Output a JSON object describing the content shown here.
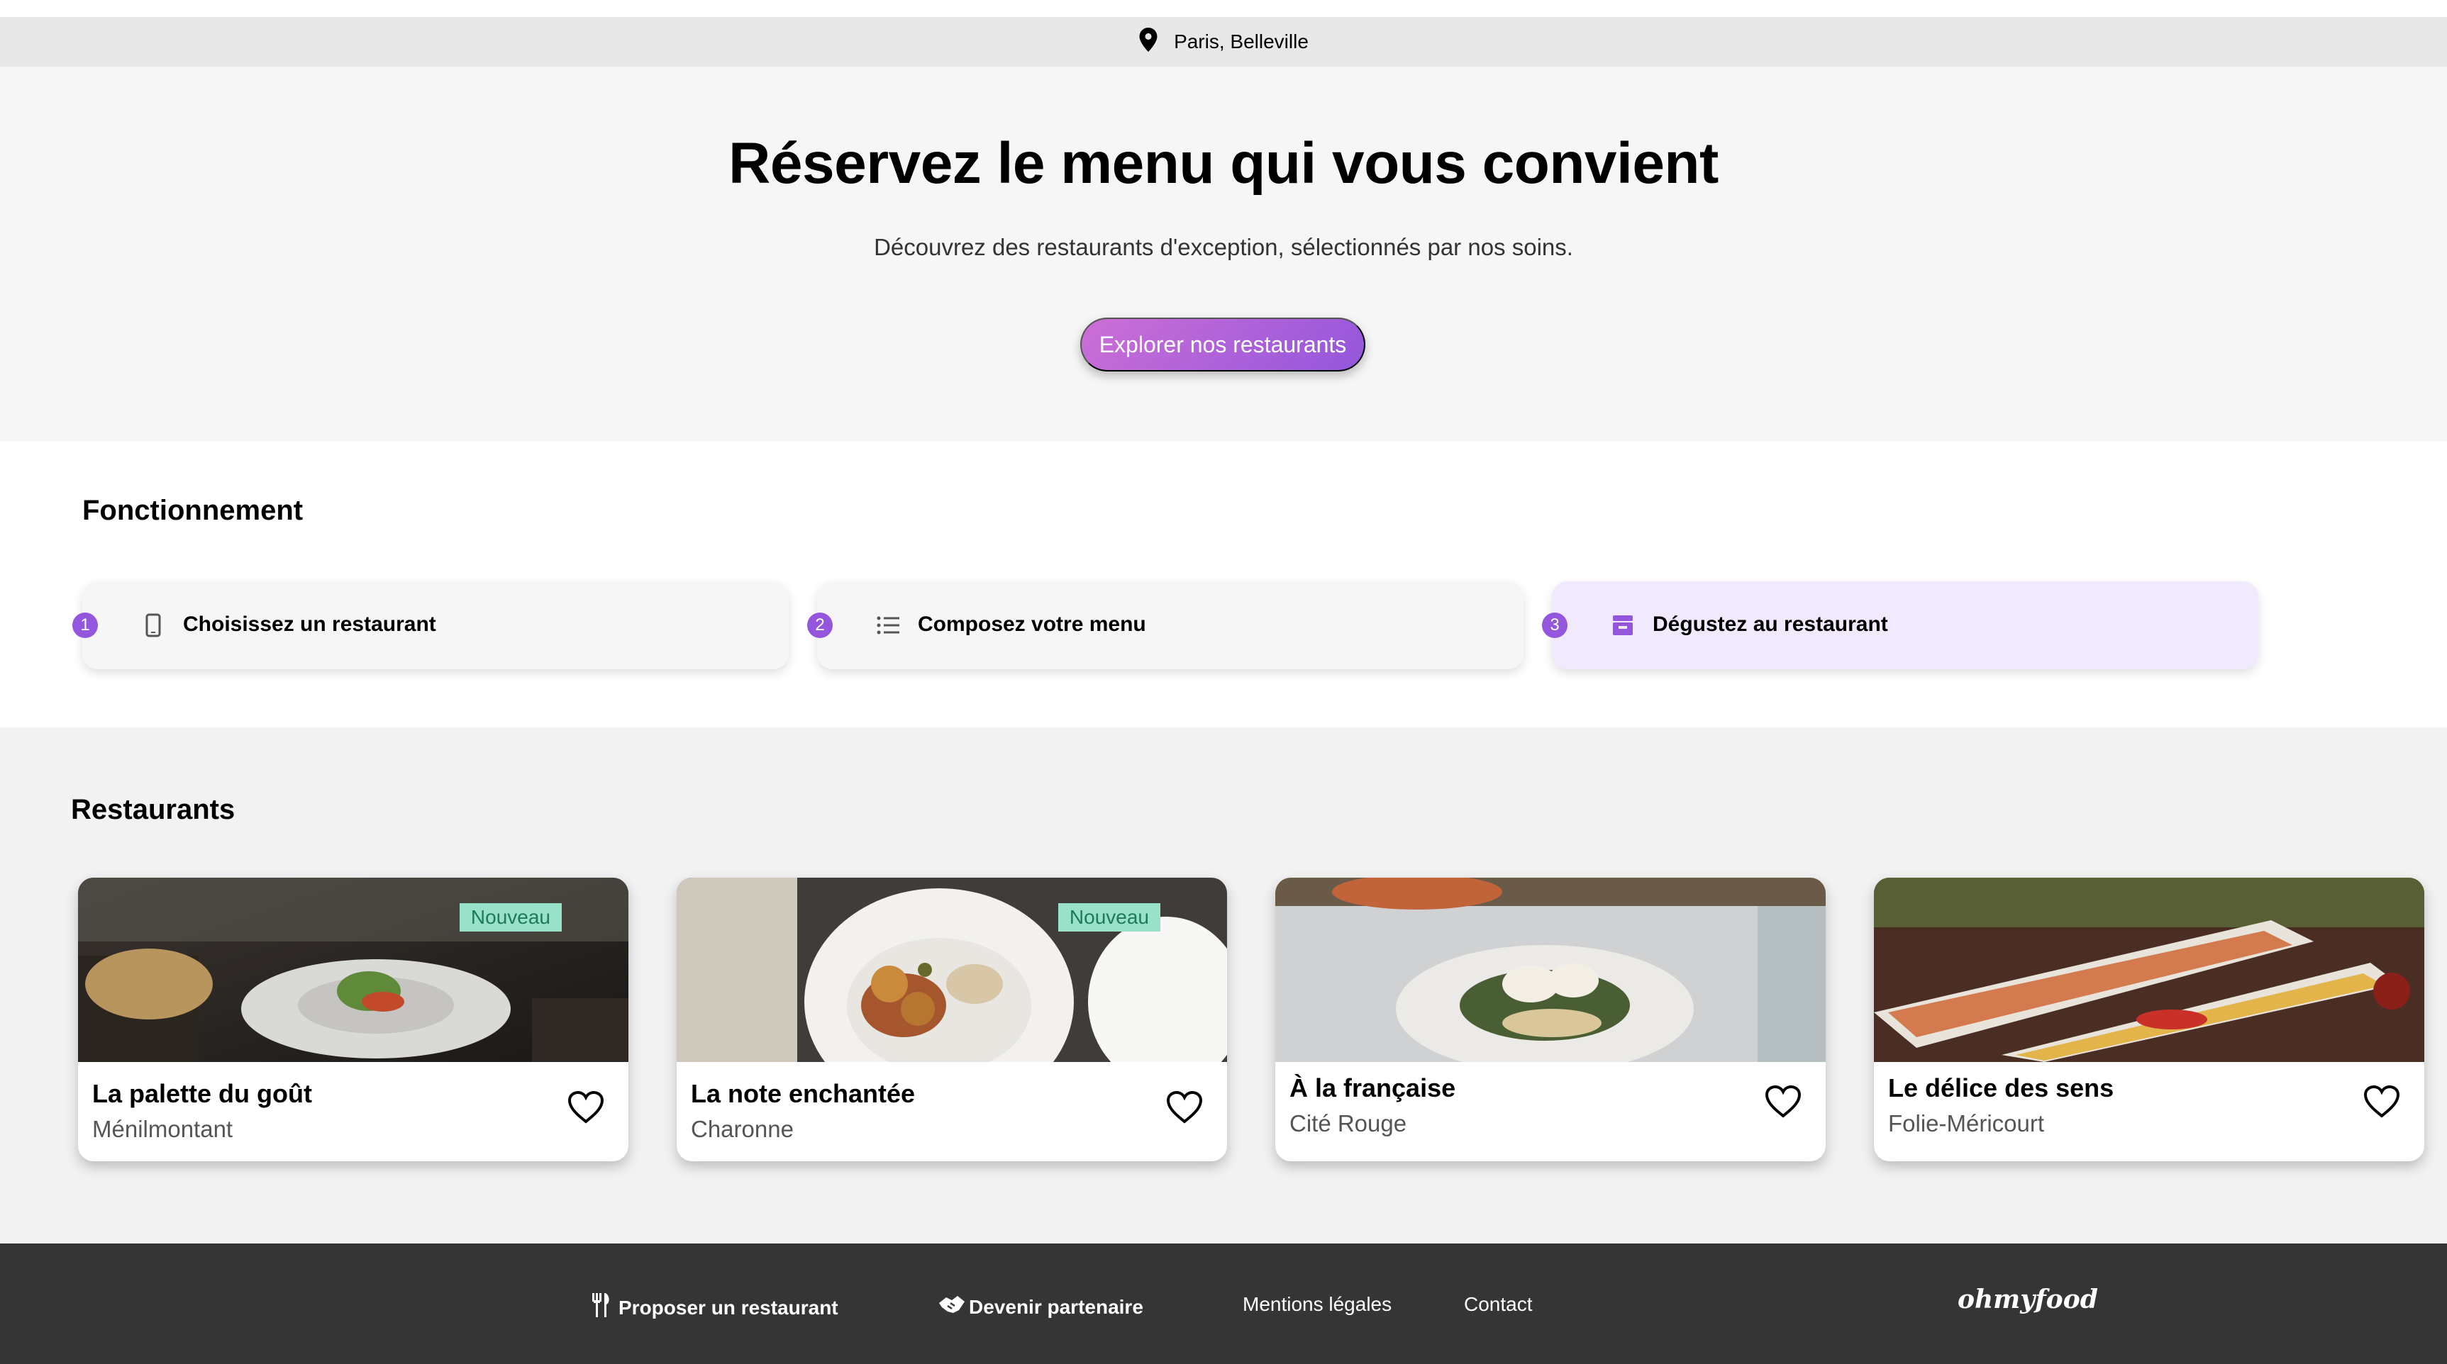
{
  "location": {
    "text": "Paris, Belleville",
    "icon": "map-pin-icon"
  },
  "hero": {
    "title": "Réservez le menu qui vous convient",
    "subtitle": "Découvrez des restaurants d'exception, sélectionnés par nos soins.",
    "cta_label": "Explorer nos restaurants"
  },
  "how_it_works": {
    "title": "Fonctionnement",
    "steps": [
      {
        "number": "1",
        "label": "Choisissez un restaurant",
        "icon": "smartphone-icon"
      },
      {
        "number": "2",
        "label": "Composez votre menu",
        "icon": "list-icon"
      },
      {
        "number": "3",
        "label": "Dégustez au restaurant",
        "icon": "store-icon"
      }
    ]
  },
  "restaurants": {
    "title": "Restaurants",
    "items": [
      {
        "name": "La palette du goût",
        "area": "Ménilmontant",
        "badge": "Nouveau"
      },
      {
        "name": "La note enchantée",
        "area": "Charonne",
        "badge": "Nouveau"
      },
      {
        "name": "À la française",
        "area": "Cité Rouge"
      },
      {
        "name": "Le délice des sens",
        "area": "Folie-Méricourt"
      }
    ]
  },
  "footer": {
    "links": [
      {
        "label": "Proposer un restaurant",
        "icon": "utensils-icon"
      },
      {
        "label": "Devenir partenaire",
        "icon": "handshake-icon"
      },
      {
        "label": "Mentions légales"
      },
      {
        "label": "Contact"
      }
    ],
    "logo": "ohmyfood"
  },
  "colors": {
    "accent": "#9356dc",
    "accent_light": "#cd6fd6",
    "badge_bg": "#99e2c9",
    "footer_bg": "#353535"
  }
}
